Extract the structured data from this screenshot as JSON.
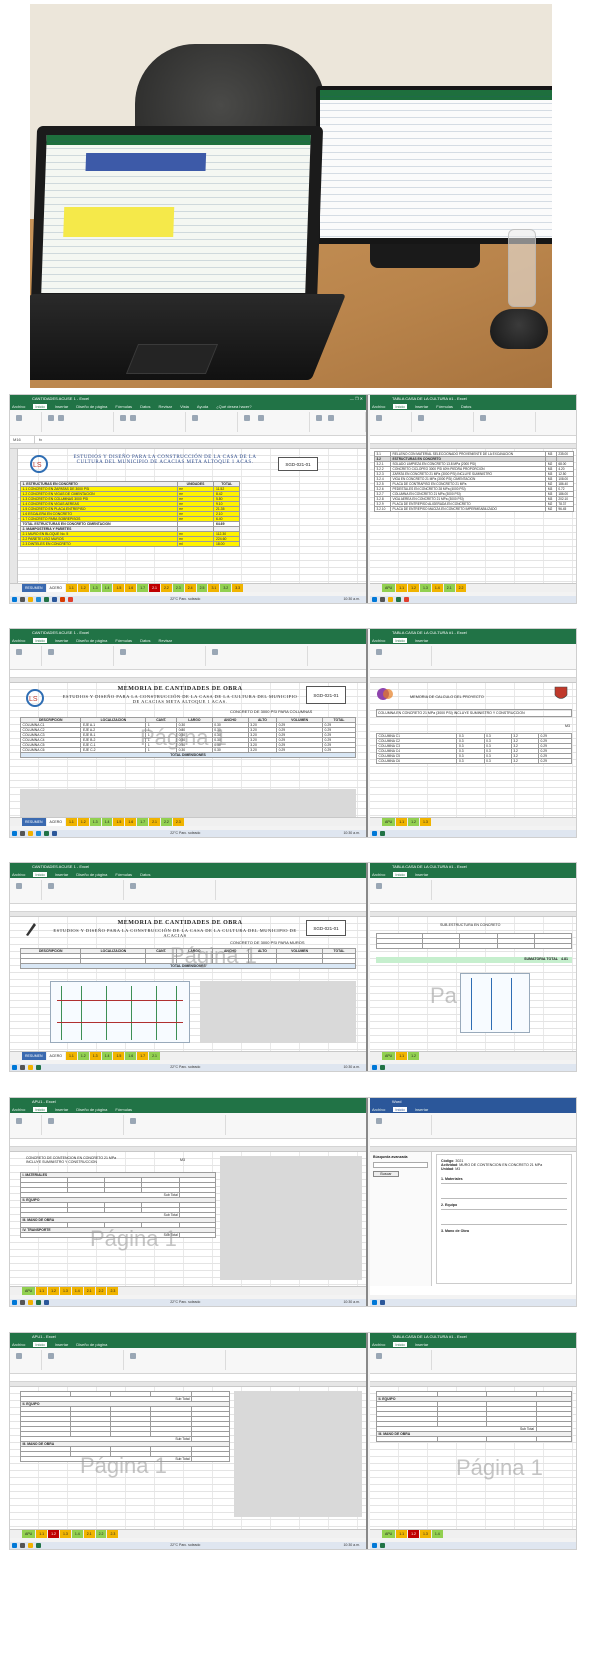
{
  "excel": {
    "menu": [
      "Archivo",
      "Inicio",
      "Insertar",
      "Diseño de página",
      "Fórmulas",
      "Datos",
      "Revisar",
      "Vista",
      "Ayuda",
      "¿Qué desea hacer?"
    ],
    "cell_ref": "M16",
    "weather": "22°C Parc. soleado",
    "clock": "10:30 a.m."
  },
  "shot1": {
    "title_left": "CANTIDADES ACUSE 1 - Excel",
    "title_right": "TABLA CASA DE LA CULTURA #1 - Excel",
    "doc_title": "ESTUDIOS Y DISEÑO PARA LA CONSTRUCCIÓN DE LA CASA DE LA CULTURA DEL MUNICIPIO DE ACACIAS META ALTOQUE 1 ACAS.",
    "code": "SGD-021-01",
    "section_header": "1. ESTRUCTURAS EN CONCRETO",
    "header_cols": [
      "UNIDADES",
      "TOTAL"
    ],
    "rows": [
      {
        "n": "1.1",
        "d": "CONCRETO EN ZAPATAS DE 3000 PSI",
        "u": "m³",
        "t": "11.52"
      },
      {
        "n": "1.2",
        "d": "CONCRETO EN VIGAS DE CIMENTACION",
        "u": "m³",
        "t": "8.42"
      },
      {
        "n": "1.3",
        "d": "CONCRETO EN COLUMNAS 3000 PSI",
        "u": "m³",
        "t": "5.80"
      },
      {
        "n": "1.4",
        "d": "CONCRETO EN VIGAS AEREAS",
        "u": "m³",
        "t": "9.10"
      },
      {
        "n": "1.5",
        "d": "CONCRETO EN PLACA ENTREPISO",
        "u": "m³",
        "t": "21.35"
      },
      {
        "n": "1.6",
        "d": "ESCALERA EN CONCRETO",
        "u": "m³",
        "t": "2.10"
      },
      {
        "n": "1.7",
        "d": "CONCRETO PARA SOBREPISOS",
        "u": "m³",
        "t": "6.40"
      }
    ],
    "subtotal_label": "TOTAL ESTRUCTURAS EN CONCRETO CIMENTACION",
    "subtotal_value": "64.69",
    "section2_header": "2. MAMPOSTERIA Y PAÑETES",
    "rows2": [
      {
        "n": "2.1",
        "d": "MURO EN BLOQUE No. 5",
        "u": "m²",
        "t": "112.30"
      },
      {
        "n": "2.2",
        "d": "PAÑETE LISO MUROS",
        "u": "m²",
        "t": "224.60"
      },
      {
        "n": "2.3",
        "d": "DINTELES EN CONCRETO",
        "u": "ml",
        "t": "18.00"
      }
    ],
    "right_rows": [
      {
        "n": "3.1",
        "d": "RELLENO CON MATERIAL SELECCIONADO PROVENIENTE DE LA EXCAVACION",
        "u": "M3",
        "v": "235.00"
      },
      {
        "n": "3.2",
        "d": "ESTRUCTURAS EN CONCRETO",
        "u": "",
        "v": ""
      },
      {
        "n": "3.2.1",
        "d": "SOLADO LIMPIEZA EN CONCRETO 13.8 MPa (2000 PSI)",
        "u": "M2",
        "v": "68.00"
      },
      {
        "n": "3.2.2",
        "d": "CONCRETO CICLOPEO 3000 PSI 60% PIEDRA PROPORCION",
        "u": "M3",
        "v": "4.20"
      },
      {
        "n": "3.2.3",
        "d": "ZAPATA EN CONCRETO 21 MPa (3000 PSI) INCLUYE SUMINISTRO",
        "u": "M3",
        "v": "12.50"
      },
      {
        "n": "3.2.4",
        "d": "VIGA EN CONCRETO 21 MPa (3000 PSI) CIMENTACION",
        "u": "M3",
        "v": "108.00"
      },
      {
        "n": "3.2.5",
        "d": "PLACA DE CONTRAPISO EN CONCRETO 21 MPa",
        "u": "M2",
        "v": "186.40"
      },
      {
        "n": "3.2.6",
        "d": "PEDESTALES EN CONCRETO 28 MPa (4000 PSI)",
        "u": "M3",
        "v": "0.72"
      },
      {
        "n": "3.2.7",
        "d": "COLUMNA EN CONCRETO 21 MPa (3000 PSI)",
        "u": "M3",
        "v": "186.00"
      },
      {
        "n": "3.2.8",
        "d": "VIGA AEREA EN CONCRETO 21 MPa (3000 PSI)",
        "u": "M3",
        "v": "202.10"
      },
      {
        "n": "3.2.9",
        "d": "PLACA DE ENTREPISO ALIGERADA EN CONCRETO",
        "u": "M2",
        "v": "78.37"
      },
      {
        "n": "3.2.10",
        "d": "PLACA DE ENTREPISO MACIZA EN CONCRETO IMPERMEABILIZADO",
        "u": "M2",
        "v": "96.45"
      }
    ],
    "tabs_left": [
      "RESUMEN",
      "ACERO",
      "1.1",
      "1.2",
      "1.3",
      "1.4",
      "1.5",
      "1.6",
      "1.7",
      "2.1",
      "2.2",
      "2.3",
      "2.4",
      "2.5",
      "3.1",
      "3.2",
      "3.3",
      "3.4",
      "4.1"
    ],
    "tabs_right": [
      "APU",
      "1.1",
      "1.2",
      "1.3",
      "1.4",
      "2.1",
      "2.2",
      "2.3",
      "3.1",
      "3.2",
      "3.3",
      "4.1"
    ]
  },
  "shot2": {
    "title_left": "CANTIDADES ACUSE 1 - Excel",
    "title_right": "TABLA CASA DE LA CULTURA #1 - Excel",
    "memo_title": "MEMORIA DE CANTIDADES DE OBRA",
    "doc_title": "ESTUDIOS Y DISEÑO PARA LA CONSTRUCCIÓN DE LA CASA DE LA CULTURA DEL MUNICIPIO DE ACACIAS META ALTOQUE 1 ACAS.",
    "code": "SGD-021-01",
    "desc": "CONCRETO DE 3000 PSI PARA COLUMNAS",
    "watermark": "Página 1",
    "cols": [
      "DESCRIPCION",
      "LOCALIZACION",
      "CANT.",
      "LARGO",
      "ANCHO",
      "ALTO",
      "VOLUMEN",
      "TOTAL"
    ],
    "rows": [
      {
        "d": "COLUMNA C1",
        "l": "EJE A-1",
        "c": "1",
        "la": "0.30",
        "an": "0.30",
        "al": "3.20",
        "v": "0.29",
        "t": "0.29"
      },
      {
        "d": "COLUMNA C2",
        "l": "EJE A-2",
        "c": "1",
        "la": "0.30",
        "an": "0.30",
        "al": "3.20",
        "v": "0.29",
        "t": "0.29"
      },
      {
        "d": "COLUMNA C3",
        "l": "EJE B-1",
        "c": "1",
        "la": "0.30",
        "an": "0.30",
        "al": "3.20",
        "v": "0.29",
        "t": "0.29"
      },
      {
        "d": "COLUMNA C4",
        "l": "EJE B-2",
        "c": "1",
        "la": "0.30",
        "an": "0.30",
        "al": "3.20",
        "v": "0.29",
        "t": "0.29"
      },
      {
        "d": "COLUMNA C5",
        "l": "EJE C-1",
        "c": "1",
        "la": "0.30",
        "an": "0.30",
        "al": "3.20",
        "v": "0.29",
        "t": "0.29"
      },
      {
        "d": "COLUMNA C6",
        "l": "EJE C-2",
        "c": "1",
        "la": "0.30",
        "an": "0.30",
        "al": "3.20",
        "v": "0.29",
        "t": "0.29"
      }
    ],
    "total_label": "TOTAL DIMENSIONES",
    "right_title": "MEMORIA DE CALCULO DEL PROYECTO",
    "right_item": "COLUMNA EN CONCRETO 21 MPa (3000 PSI) INCLUYE SUMINISTRO Y CONSTRUCCION",
    "right_unit": "M3",
    "right_rows": [
      {
        "d": "COLUMNA C1",
        "a": "0.3",
        "b": "0.3",
        "c": "3.2",
        "t": "0.29"
      },
      {
        "d": "COLUMNA C2",
        "a": "0.3",
        "b": "0.3",
        "c": "3.2",
        "t": "0.29"
      },
      {
        "d": "COLUMNA C3",
        "a": "0.3",
        "b": "0.3",
        "c": "3.2",
        "t": "0.29"
      },
      {
        "d": "COLUMNA C4",
        "a": "0.3",
        "b": "0.3",
        "c": "3.2",
        "t": "0.29"
      },
      {
        "d": "COLUMNA C5",
        "a": "0.3",
        "b": "0.3",
        "c": "3.2",
        "t": "0.29"
      },
      {
        "d": "COLUMNA C6",
        "a": "0.3",
        "b": "0.3",
        "c": "3.2",
        "t": "0.29"
      }
    ]
  },
  "shot3": {
    "memo_title": "MEMORIA DE CANTIDADES DE OBRA",
    "doc_title": "ESTUDIOS Y DISEÑO PARA LA CONSTRUCCIÓN DE LA CASA DE LA CULTURA DEL MUNICIPIO DE ACACIAS",
    "code": "SGD-021-01",
    "desc": "CONCRETO DE 3000 PSI PARA MUROS",
    "watermark": "Página 1",
    "total_label": "TOTAL DIMENSIONES",
    "right_header": "SUB-ESTRUCTURA EN CONCRETO",
    "right_total_label": "SUMATORIA TOTAL",
    "right_total": "4.81",
    "right_watermark": "Pa"
  },
  "shot4": {
    "title_left": "APU1 - Excel",
    "item_label": "CONCRETO DE CONTENCION EN CONCRETO 21 MPa INCLUYE SUMINISTRO Y CONSTRUCCION",
    "unit": "M3",
    "section_materials": "I. MATERIALES",
    "section_equipment": "II. EQUIPO",
    "section_labor": "III. MANO DE OBRA",
    "section_transport": "IV. TRANSPORTE",
    "watermark": "Página 1",
    "subtotal": "Sub Total",
    "search_title": "Búsqueda avanzada",
    "search_button": "Buscar",
    "right_panel": [
      {
        "k": "Código",
        "v": "3021"
      },
      {
        "k": "Actividad",
        "v": "MURO DE CONTENCION EN CONCRETO 21 MPa"
      },
      {
        "k": "Unidad",
        "v": "M3"
      }
    ],
    "right_sections": [
      "1. Materiales",
      "2. Equipo",
      "3. Mano de Obra"
    ]
  },
  "shot5": {
    "section_equipment": "II. EQUIPO",
    "section_labor": "III. MANO DE OBRA",
    "watermark_left": "Página 1",
    "watermark_right": "Página 1",
    "subtotal": "Sub Total"
  }
}
